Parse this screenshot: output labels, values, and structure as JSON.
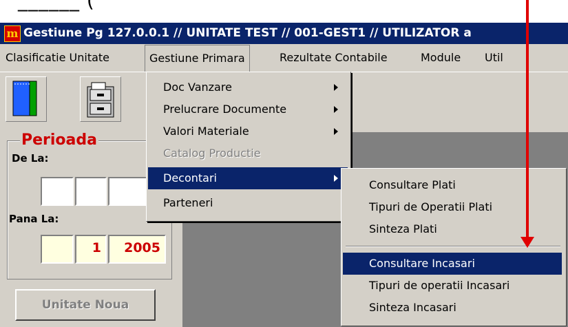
{
  "top_text": "______ (",
  "titlebar": {
    "text": "Gestiune Pg 127.0.0.1 // UNITATE TEST // 001-GEST1 // UTILIZATOR a",
    "icon": "app-logo-icon"
  },
  "menubar": [
    {
      "label": "Clasificatie Unitate"
    },
    {
      "label": "Gestiune Primara"
    },
    {
      "label": "Rezultate Contabile"
    },
    {
      "label": "Module"
    },
    {
      "label": "Util"
    }
  ],
  "gestiune_menu": [
    {
      "label": "Doc Vanzare",
      "submenu": true
    },
    {
      "label": "Prelucrare Documente",
      "submenu": true
    },
    {
      "label": "Valori Materiale",
      "submenu": true
    },
    {
      "label": "Catalog Productie",
      "disabled": true
    },
    {
      "label": "Decontari",
      "submenu": true,
      "selected": true
    },
    {
      "label": "Parteneri"
    }
  ],
  "decontari_menu": [
    {
      "label": "Consultare Plati"
    },
    {
      "label": "Tipuri de Operatii Plati"
    },
    {
      "label": "Sinteza Plati"
    },
    {
      "label": "Consultare Incasari",
      "selected": true
    },
    {
      "label": "Tipuri de operatii Incasari"
    },
    {
      "label": "Sinteza Incasari"
    }
  ],
  "panel": {
    "title": "Perioada",
    "de_la": "De La:",
    "pana_la": "Pana La:",
    "pana_month": "1",
    "pana_year": "2005",
    "unitate_noua": "Unitate Noua"
  },
  "colors": {
    "title_blue": "#0a246a",
    "accent_red": "#cc0000",
    "arrow_red": "#e00000"
  }
}
